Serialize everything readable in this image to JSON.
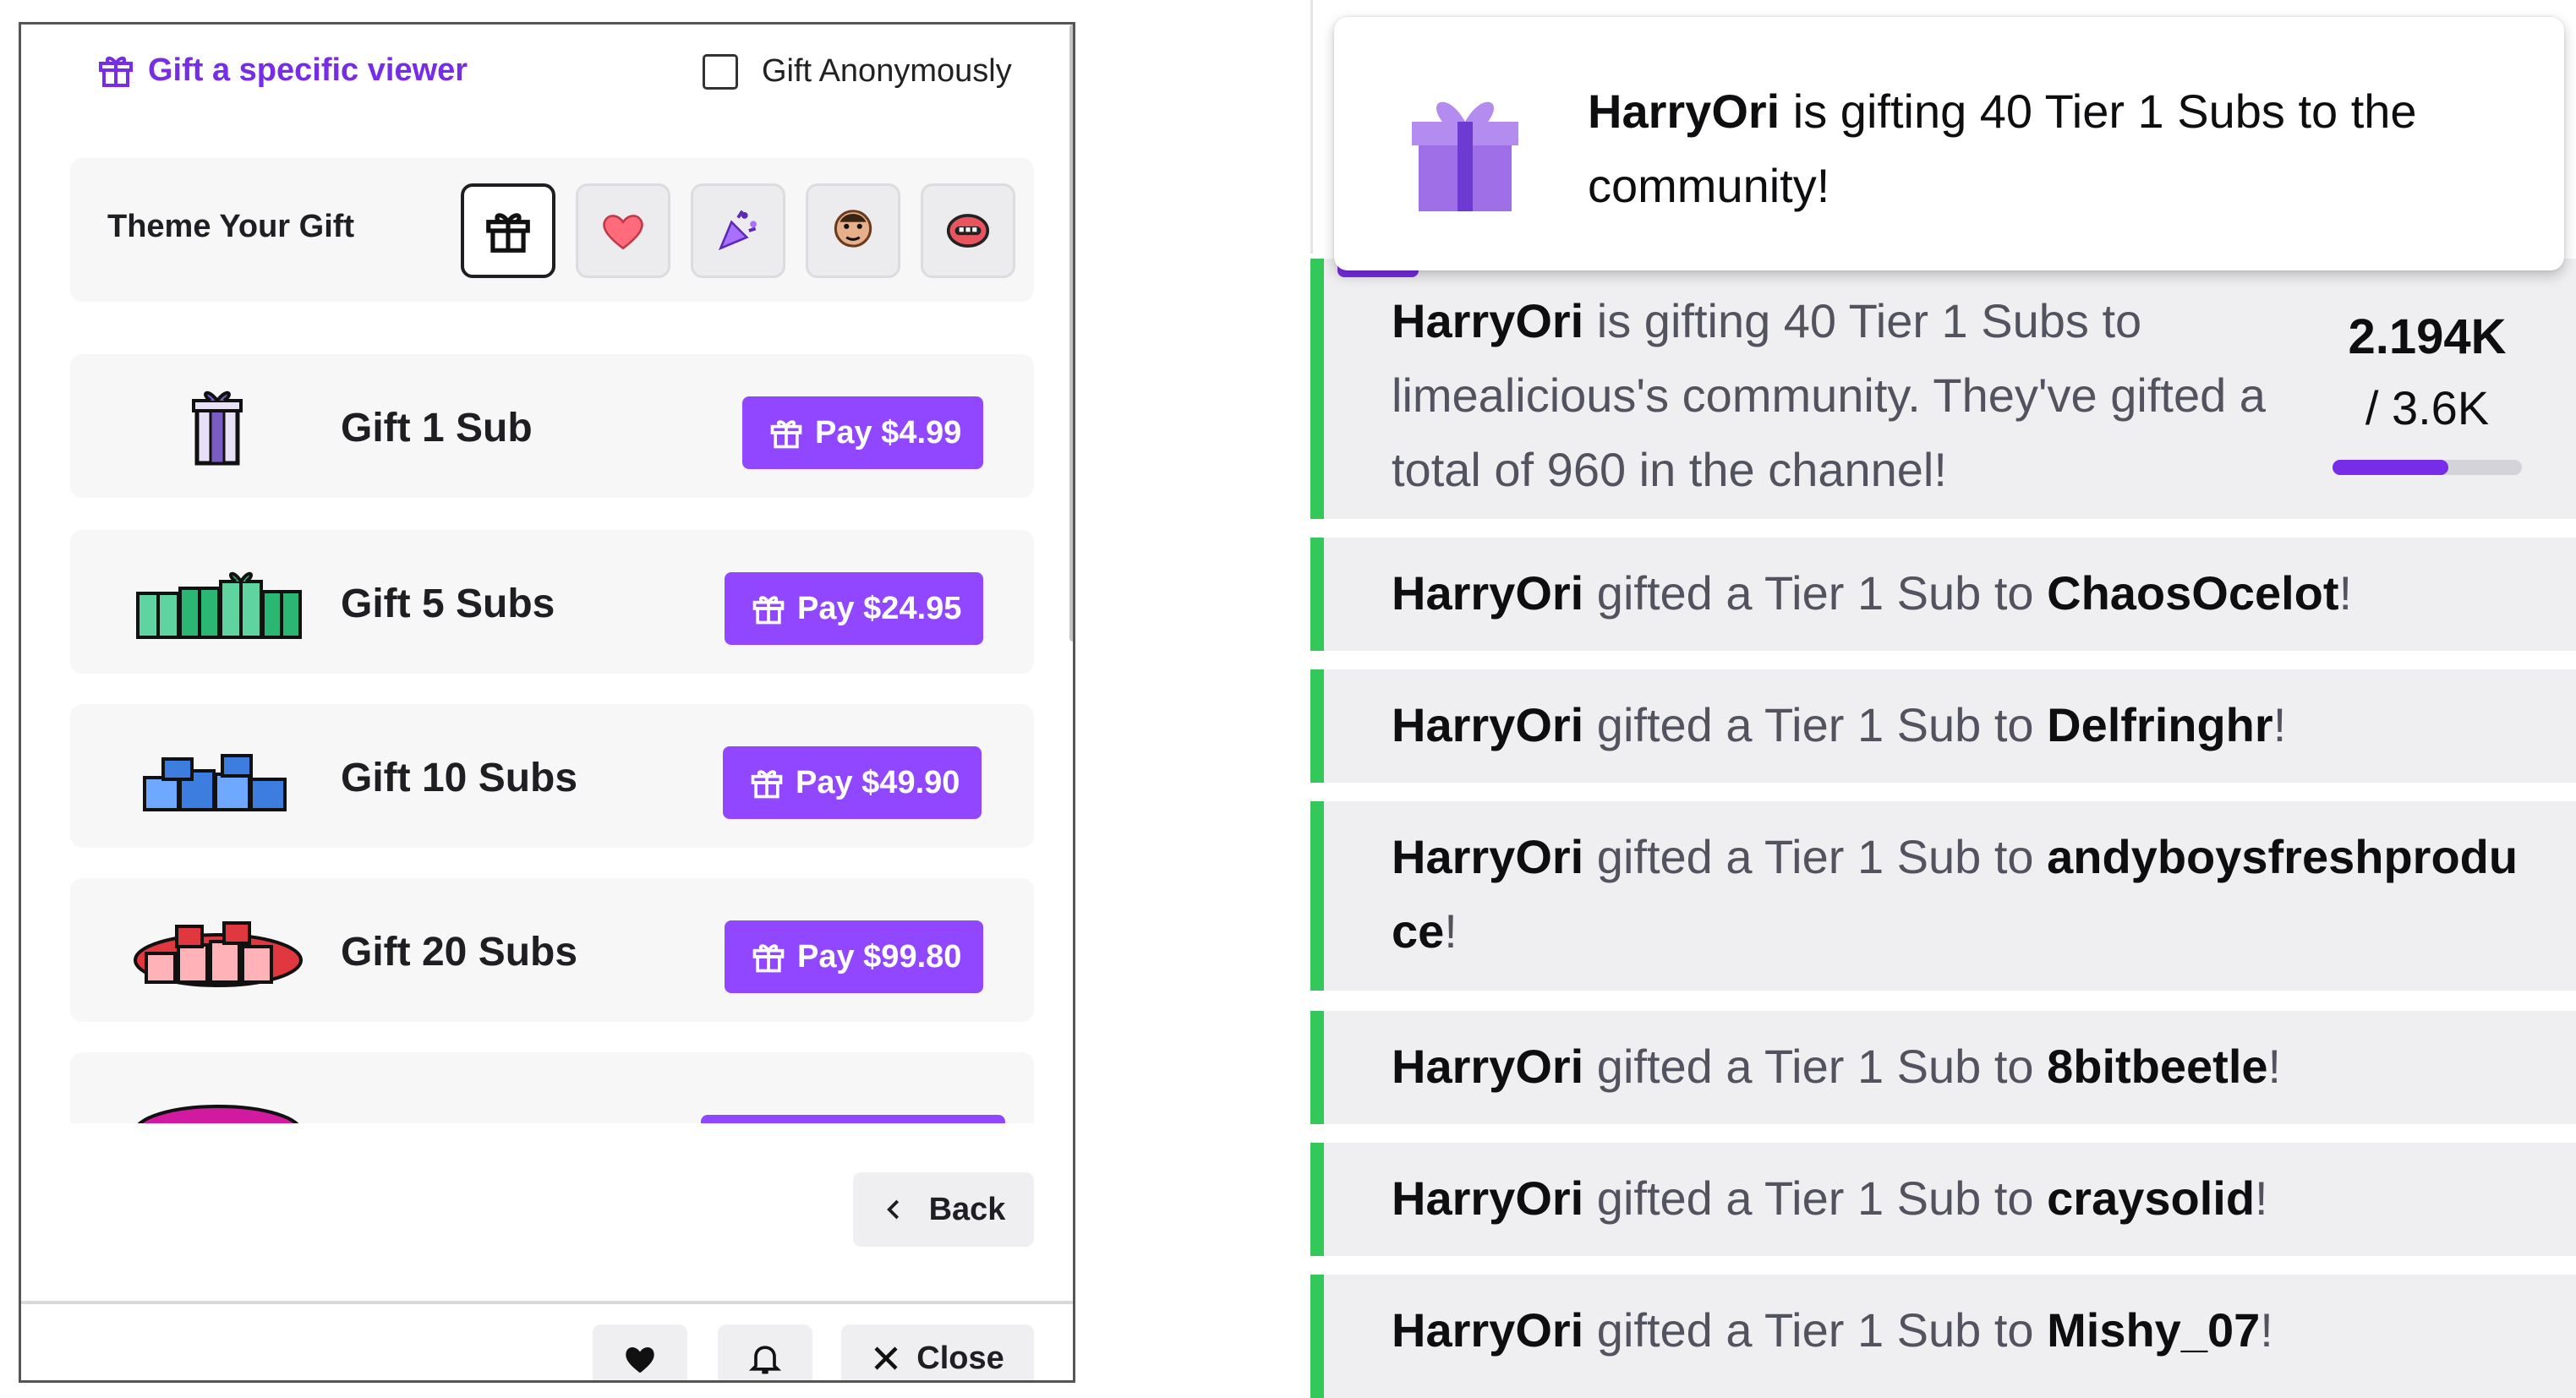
{
  "left_panel": {
    "gift_specific_viewer": "Gift a specific viewer",
    "gift_anonymously": "Gift Anonymously",
    "theme_label": "Theme Your Gift",
    "theme_options": [
      "gift-icon",
      "heart-icon",
      "party-popper-icon",
      "face-emote-icon",
      "lips-emote-icon"
    ],
    "gifts": [
      {
        "label": "Gift 1 Sub",
        "pay": "Pay $4.99",
        "color": "#7a5cc4"
      },
      {
        "label": "Gift 5 Subs",
        "pay": "Pay $24.95",
        "color": "#2bb673"
      },
      {
        "label": "Gift 10 Subs",
        "pay": "Pay $49.90",
        "color": "#3d7de0"
      },
      {
        "label": "Gift 20 Subs",
        "pay": "Pay $99.80",
        "color": "#e0383e"
      }
    ],
    "back_label": "Back",
    "close_label": "Close",
    "accent_color": "#9147ff"
  },
  "right_panel": {
    "notification": {
      "user": "HarryOri",
      "text": " is gifting 40 Tier 1 Subs to the community!"
    },
    "summary": {
      "user": "HarryOri",
      "text": " is gifting 40 Tier 1 Subs to limealicious's community. They've gifted a total of 960 in the channel!",
      "progress_value": "2.194K",
      "progress_total": "/ 3.6K",
      "progress_fraction": 0.61
    },
    "gift_events": [
      {
        "user": "HarryOri",
        "middle": " gifted a Tier 1 Sub to ",
        "recipient": "ChaosOcelot",
        "end": "!"
      },
      {
        "user": "HarryOri",
        "middle": " gifted a Tier 1 Sub to ",
        "recipient": "Delfringhr",
        "end": "!"
      },
      {
        "user": "HarryOri",
        "middle": " gifted a Tier 1 Sub to ",
        "recipient": "andyboysfreshproduce",
        "end": "!"
      },
      {
        "user": "HarryOri",
        "middle": " gifted a Tier 1 Sub to ",
        "recipient": "8bitbeetle",
        "end": "!"
      },
      {
        "user": "HarryOri",
        "middle": " gifted a Tier 1 Sub to ",
        "recipient": "craysolid",
        "end": "!"
      },
      {
        "user": "HarryOri",
        "middle": " gifted a Tier 1 Sub to ",
        "recipient": "Mishy_07",
        "end": "!"
      }
    ],
    "accent_color": "#772ce8",
    "highlight_color": "#34c759"
  }
}
